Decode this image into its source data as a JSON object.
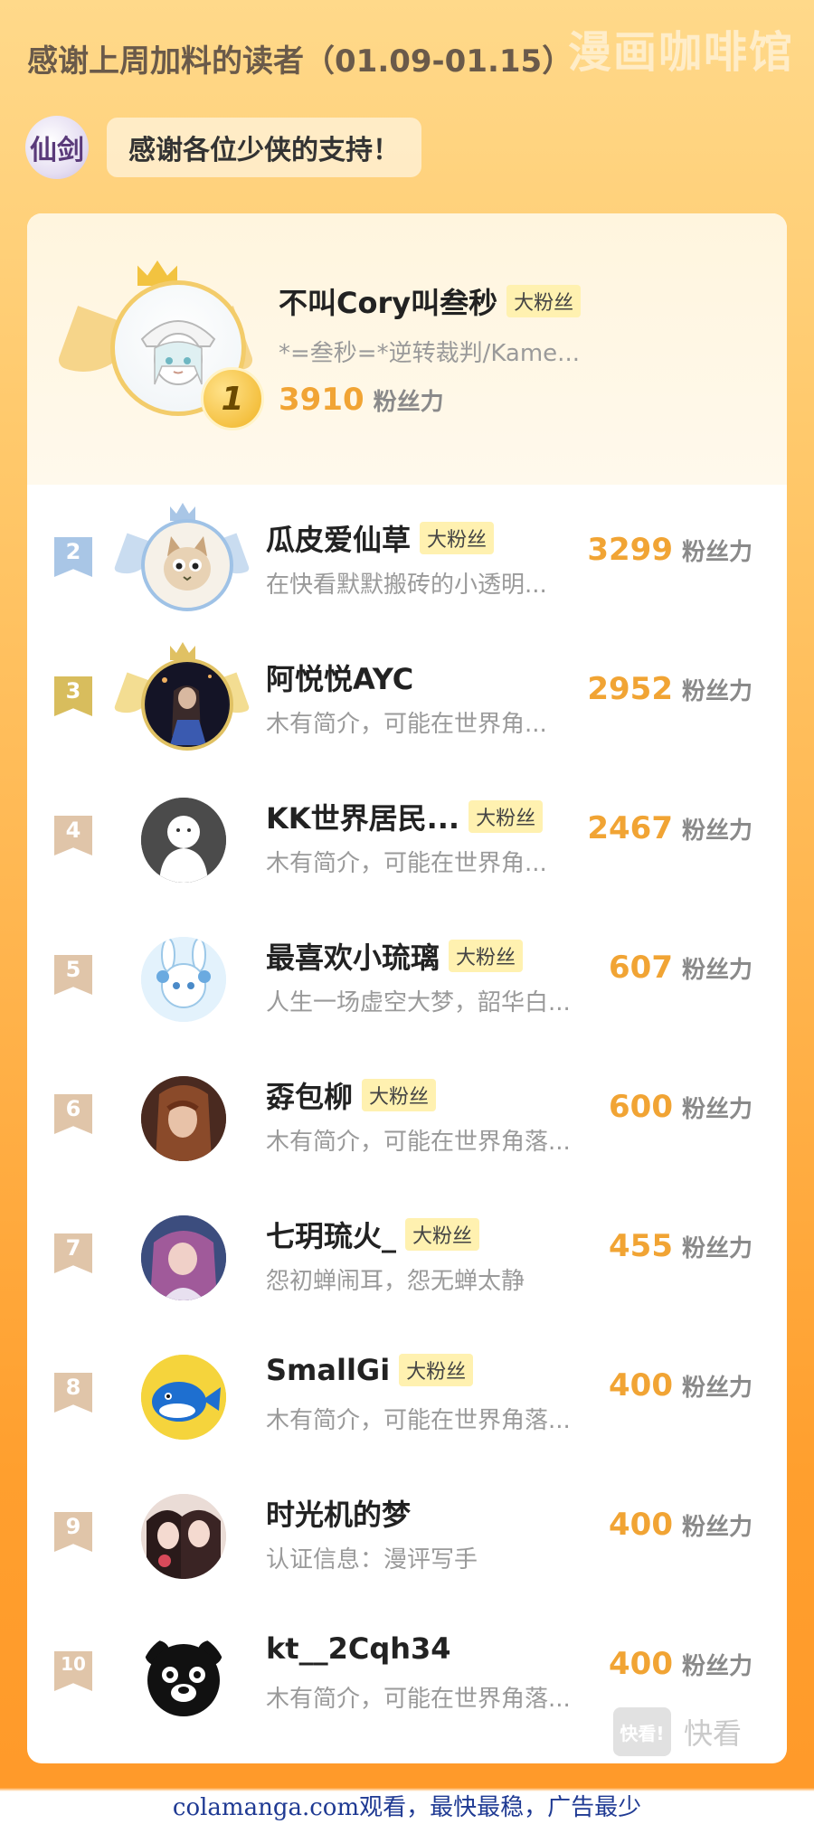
{
  "watermark_top": "漫画咖啡馆",
  "page_title": "感谢上周加料的读者（01.09-01.15）",
  "logo_text": "仙剑",
  "thanks_message": "感谢各位少侠的支持！",
  "score_unit": "粉丝力",
  "badge_label": "大粉丝",
  "top_reader": {
    "rank": "1",
    "name": "不叫Cory叫叁秒",
    "badge": "大粉丝",
    "bio": "*=叁秒=*逆转裁判/Kame...",
    "score": "3910"
  },
  "readers": [
    {
      "rank": "2",
      "name": "瓜皮爱仙草",
      "badge": "大粉丝",
      "bio": "在快看默默搬砖的小透明...",
      "score": "3299"
    },
    {
      "rank": "3",
      "name": "阿悦悦AYC",
      "badge": "",
      "bio": "木有简介，可能在世界角...",
      "score": "2952"
    },
    {
      "rank": "4",
      "name": "KK世界居民...",
      "badge": "大粉丝",
      "bio": "木有简介，可能在世界角...",
      "score": "2467"
    },
    {
      "rank": "5",
      "name": "最喜欢小琉璃",
      "badge": "大粉丝",
      "bio": "人生一场虚空大梦，韶华白...",
      "score": "607"
    },
    {
      "rank": "6",
      "name": "孬包柳",
      "badge": "大粉丝",
      "bio": "木有简介，可能在世界角落...",
      "score": "600"
    },
    {
      "rank": "7",
      "name": "七玥琉火_",
      "badge": "大粉丝",
      "bio": "怨初蝉闹耳，怨无蝉太静",
      "score": "455"
    },
    {
      "rank": "8",
      "name": "SmallGi",
      "badge": "大粉丝",
      "bio": "木有简介，可能在世界角落...",
      "score": "400"
    },
    {
      "rank": "9",
      "name": "时光机的梦",
      "badge": "",
      "bio": "认证信息：漫评写手",
      "score": "400"
    },
    {
      "rank": "10",
      "name": "kt__2Cqh34",
      "badge": "",
      "bio": "木有简介，可能在世界角落...",
      "score": "400"
    }
  ],
  "watermark_bottom_logo": "快看!",
  "watermark_bottom_text": "快看",
  "footer_text": "colamanga.com观看，最快最稳，广告最少"
}
